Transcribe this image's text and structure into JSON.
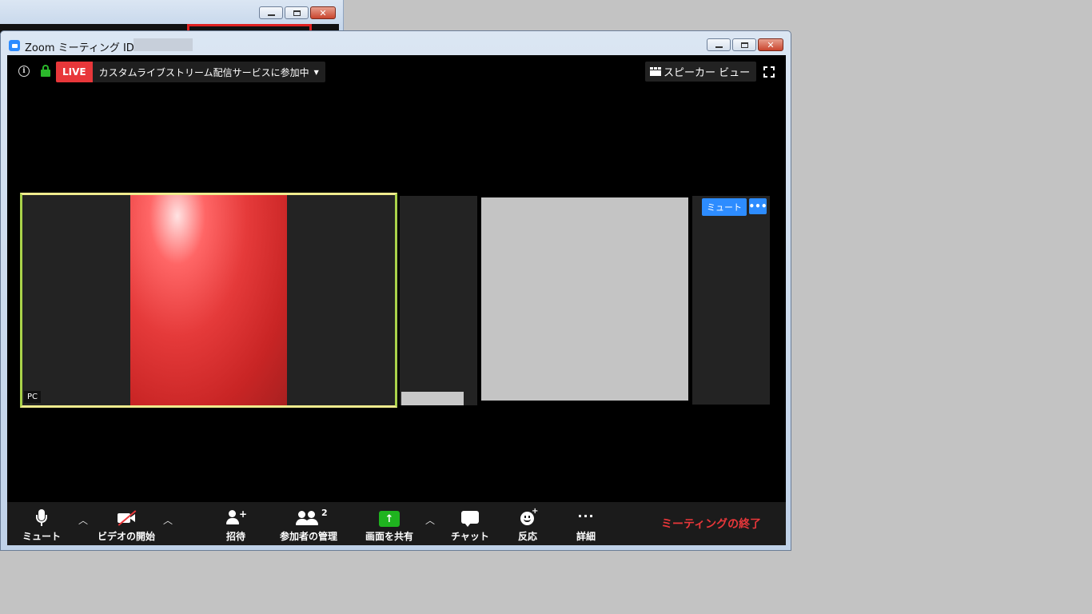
{
  "window": {
    "title": "Zoom ミーティング ID:"
  },
  "top_bar": {
    "live_badge": "LIVE",
    "live_status": "カスタムライブストリーム配信サービスに参加中",
    "view_button": "スピーカー ビュー"
  },
  "tiles": {
    "main_name": "PC",
    "mute_button": "ミュート",
    "more_button": "•••"
  },
  "toolbar": {
    "mute": "ミュート",
    "video": "ビデオの開始",
    "invite": "招待",
    "participants": "参加者の管理",
    "participant_count": "2",
    "share": "画面を共有",
    "chat": "チャット",
    "reaction": "反応",
    "more": "詳細",
    "end": "ミーティングの終了"
  },
  "colors": {
    "accent_blue": "#2d8cff",
    "live_red": "#e8373a",
    "share_green": "#1fb41f",
    "active_speaker_border": "#f0eb8e"
  }
}
